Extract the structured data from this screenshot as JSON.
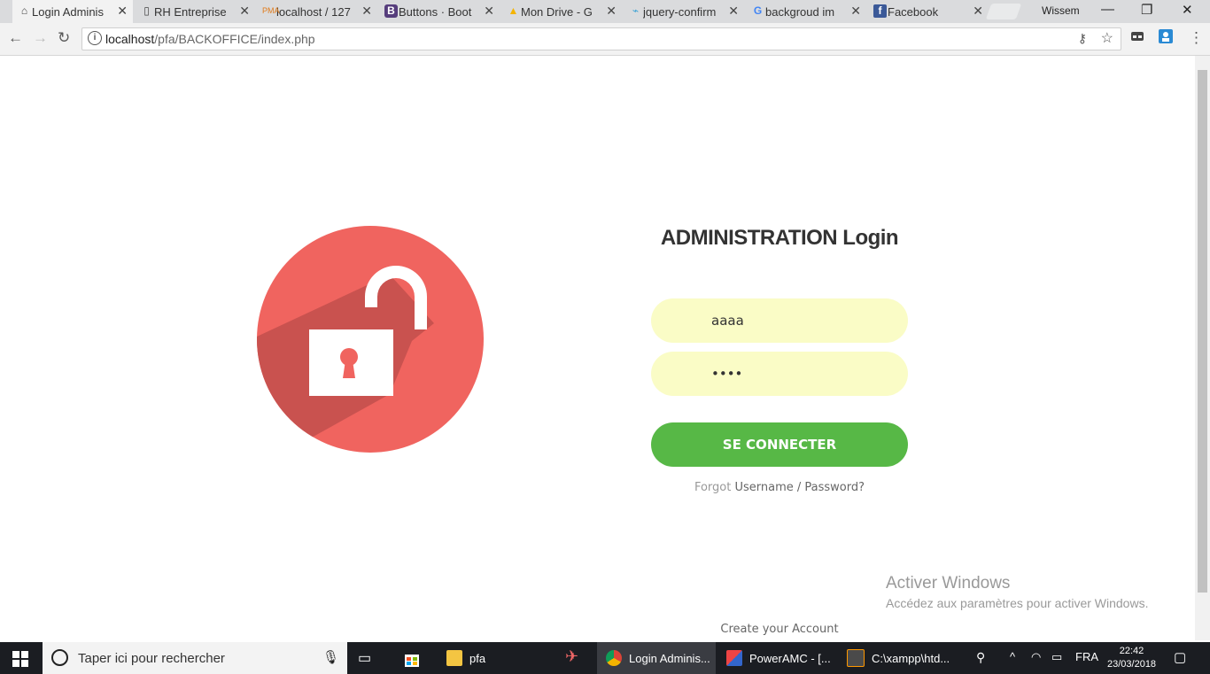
{
  "browser": {
    "tabs": [
      {
        "title": "Login Adminis",
        "icon": "home-icon",
        "active": true
      },
      {
        "title": "RH Entreprise",
        "icon": "page-icon"
      },
      {
        "title": "localhost / 127",
        "icon": "phpmyadmin-icon"
      },
      {
        "title": "Buttons · Boot",
        "icon": "bootstrap-icon"
      },
      {
        "title": "Mon Drive - G",
        "icon": "drive-icon"
      },
      {
        "title": "jquery-confirm",
        "icon": "jquery-icon"
      },
      {
        "title": "backgroud im",
        "icon": "google-icon"
      },
      {
        "title": "Facebook",
        "icon": "facebook-icon"
      }
    ],
    "profile_name": "Wissem",
    "url_host": "localhost",
    "url_path": "/pfa/BACKOFFICE/index.php"
  },
  "page": {
    "title": "ADMINISTRATION Login",
    "username_value": "aaaa",
    "password_value": "••••",
    "login_button": "SE CONNECTER",
    "forgot_prefix": "Forgot",
    "forgot_link": "Username / Password?",
    "create_account": "Create your Account",
    "accent_color": "#57b846",
    "lock_color": "#f0645f"
  },
  "watermark": {
    "line1": "Activer Windows",
    "line2": "Accédez aux paramètres pour activer Windows."
  },
  "taskbar": {
    "search_placeholder": "Taper ici pour rechercher",
    "items": [
      {
        "label": "pfa",
        "icon": "folder-icon"
      },
      {
        "label": "Login Adminis...",
        "icon": "chrome-icon",
        "active": true
      },
      {
        "label": "PowerAMC - [...",
        "icon": "poweramc-icon"
      },
      {
        "label": "C:\\xampp\\htd...",
        "icon": "sublime-icon"
      }
    ],
    "language": "FRA",
    "time": "22:42",
    "date": "23/03/2018"
  }
}
